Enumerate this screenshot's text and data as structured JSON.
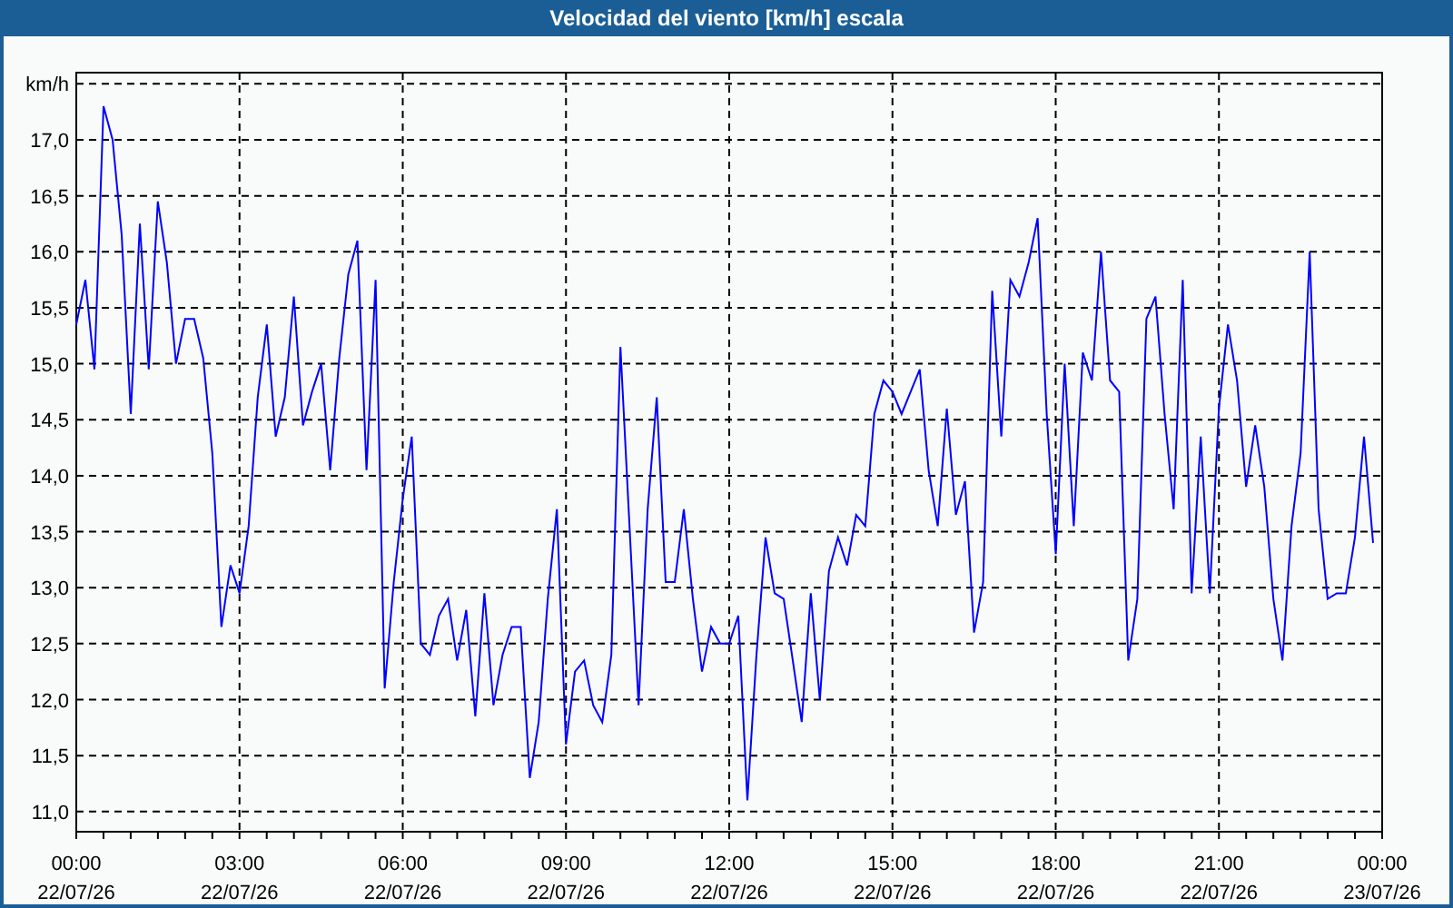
{
  "window": {
    "title": "Velocidad del viento [km/h] escala"
  },
  "chart": {
    "chart_data": {
      "type": "line",
      "grid": true,
      "ylim": [
        10.82,
        17.6
      ],
      "categories": [
        "00:00 22/07/26",
        null,
        null,
        null,
        null,
        null,
        null,
        null,
        null,
        null,
        null,
        null,
        null,
        null,
        null,
        null,
        null,
        null,
        "03:00 22/07/26",
        null,
        null,
        null,
        null,
        null,
        null,
        null,
        null,
        null,
        null,
        null,
        null,
        null,
        null,
        null,
        null,
        null,
        "06:00 22/07/26",
        null,
        null,
        null,
        null,
        null,
        null,
        null,
        null,
        null,
        null,
        null,
        null,
        null,
        null,
        null,
        null,
        null,
        "09:00 22/07/26",
        null,
        null,
        null,
        null,
        null,
        null,
        null,
        null,
        null,
        null,
        null,
        null,
        null,
        null,
        null,
        null,
        null,
        "12:00 22/07/26",
        null,
        null,
        null,
        null,
        null,
        null,
        null,
        null,
        null,
        null,
        null,
        null,
        null,
        null,
        null,
        null,
        null,
        "15:00 22/07/26",
        null,
        null,
        null,
        null,
        null,
        null,
        null,
        null,
        null,
        null,
        null,
        null,
        null,
        null,
        null,
        null,
        null,
        "18:00 22/07/26",
        null,
        null,
        null,
        null,
        null,
        null,
        null,
        null,
        null,
        null,
        null,
        null,
        null,
        null,
        null,
        null,
        null,
        "21:00 22/07/26",
        null,
        null,
        null,
        null,
        null,
        null,
        null,
        null,
        null,
        null,
        null,
        null,
        null,
        null,
        null,
        null,
        null,
        "00:00 23/07/26"
      ],
      "yticks": [
        {
          "value": 11,
          "label": "11,0"
        },
        {
          "value": 11.5,
          "label": "11,5"
        },
        {
          "value": 12,
          "label": "12,0"
        },
        {
          "value": 12.5,
          "label": "12,5"
        },
        {
          "value": 13,
          "label": "13,0"
        },
        {
          "value": 13.5,
          "label": "13,5"
        },
        {
          "value": 14,
          "label": "14,0"
        },
        {
          "value": 14.5,
          "label": "14,5"
        },
        {
          "value": 15,
          "label": "15,0"
        },
        {
          "value": 15.5,
          "label": "15,5"
        },
        {
          "value": 16,
          "label": "16,0"
        },
        {
          "value": 16.5,
          "label": "16,5"
        },
        {
          "value": 17,
          "label": "17,0"
        },
        {
          "value": 17.5,
          "label": "km/h"
        }
      ],
      "series": [
        {
          "color": "#0000ff",
          "values": [
            15.35,
            15.75,
            14.95,
            17.3,
            17.0,
            16.15,
            14.55,
            16.25,
            14.95,
            16.45,
            15.9,
            15.0,
            15.4,
            15.4,
            15.05,
            14.2,
            12.65,
            13.2,
            12.95,
            13.55,
            14.7,
            15.35,
            14.35,
            14.7,
            15.6,
            14.45,
            14.75,
            15.0,
            14.05,
            15.05,
            15.8,
            16.1,
            14.05,
            15.75,
            12.1,
            13.05,
            13.8,
            14.35,
            12.5,
            12.4,
            12.75,
            12.9,
            12.35,
            12.8,
            11.85,
            12.95,
            11.95,
            12.4,
            12.65,
            12.65,
            11.3,
            11.8,
            12.9,
            13.7,
            11.6,
            12.25,
            12.35,
            11.95,
            11.8,
            12.4,
            15.15,
            13.55,
            11.95,
            13.7,
            14.7,
            13.05,
            13.05,
            13.7,
            12.9,
            12.25,
            12.65,
            12.5,
            12.5,
            12.75,
            11.1,
            12.4,
            13.45,
            12.95,
            12.9,
            12.35,
            11.8,
            12.95,
            12.0,
            13.15,
            13.45,
            13.2,
            13.65,
            13.55,
            14.55,
            14.85,
            14.75,
            14.55,
            14.75,
            14.95,
            14.05,
            13.55,
            14.6,
            13.65,
            13.95,
            12.6,
            13.05,
            15.65,
            14.35,
            15.75,
            15.6,
            15.9,
            16.3,
            14.55,
            13.3,
            15.0,
            13.55,
            15.1,
            14.85,
            16.0,
            14.85,
            14.75,
            12.35,
            12.9,
            15.4,
            15.6,
            14.55,
            13.7,
            15.75,
            12.95,
            14.35,
            12.95,
            14.6,
            15.35,
            14.85,
            13.9,
            14.45,
            13.9,
            12.9,
            12.35,
            13.55,
            14.2,
            16.0,
            13.7,
            12.9,
            12.95,
            12.95,
            13.45,
            14.35,
            13.4,
            null
          ]
        }
      ]
    }
  }
}
